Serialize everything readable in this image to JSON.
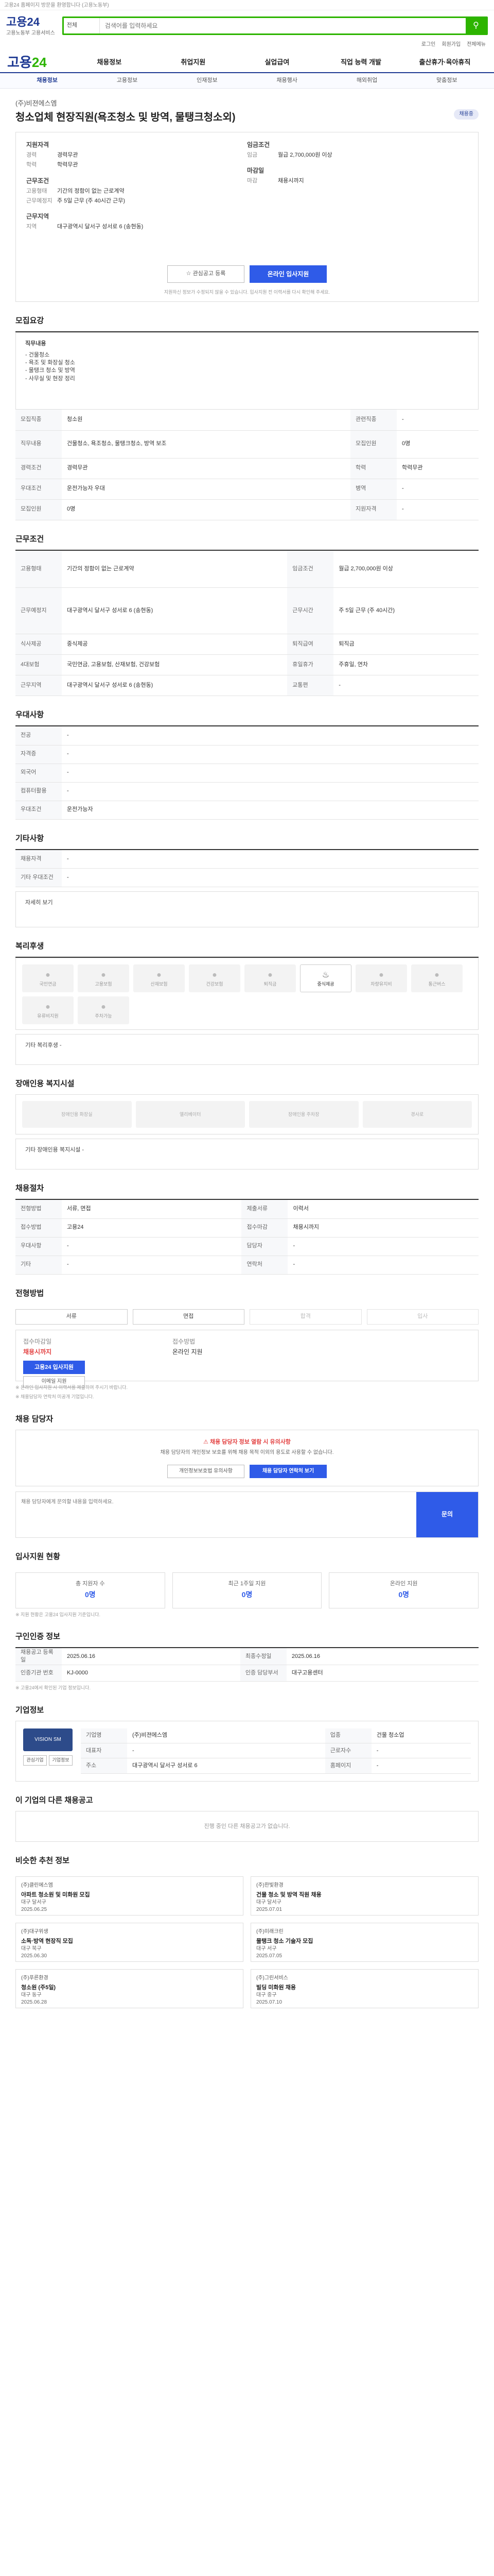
{
  "topbar": "고용24 홈페이지 방문을 환영합니다 (고용노동부)",
  "logo": {
    "main": "고용24",
    "sub": "고용노동부 고용서비스"
  },
  "search": {
    "scope": "전체",
    "placeholder": "검색어를 입력하세요"
  },
  "util": [
    "로그인",
    "회원가입",
    "전체메뉴"
  ],
  "gnb": [
    "채용정보",
    "취업지원",
    "실업급여",
    "직업 능력 개발",
    "출산휴가·육아휴직"
  ],
  "sub": [
    "채용정보",
    "고용정보",
    "인재정보",
    "채용행사",
    "해외취업",
    "맞춤정보"
  ],
  "job": {
    "company": "(주)비젼에스엠",
    "title": "청소업체 현장직원(욕조청소 및 방역, 물탱크청소외)",
    "tag": "채용중",
    "summary": {
      "g1": "지원자격",
      "g1_items": [
        [
          "경력",
          "경력무관"
        ],
        [
          "학력",
          "학력무관"
        ]
      ],
      "g2": "근무조건",
      "g2_items": [
        [
          "고용형태",
          "기간의 정함이 없는 근로계약"
        ],
        [
          "근무예정지",
          "주 5일 근무 (주 40시간 근무)"
        ]
      ],
      "g3": "근무지역",
      "g3_items": [
        [
          "지역",
          "대구광역시 달서구 성서로 6 (송현동)"
        ]
      ],
      "g4": "임금조건",
      "g4_items": [
        [
          "임금",
          "월급 2,700,000원 이상"
        ]
      ],
      "g5": "마감일",
      "g5_items": [
        [
          "마감",
          "채용시까지"
        ]
      ]
    },
    "apply_btn": "온라인 입사지원",
    "save_btn": "관심공고 등록",
    "note": "지원하신 정보가 수정되지 않을 수 있습니다. 입사지원 전 이력서를 다시 확인해 주세요."
  },
  "section_job": {
    "title": "모집요강",
    "desc_title": "직무내용",
    "desc": [
      "- 건물청소",
      "- 욕조 및 화장실 청소",
      "- 물탱크 청소 및 방역",
      "- 사무실 및 현장 정리"
    ],
    "rows": [
      [
        "모집직종",
        "청소원",
        "관련직종",
        "-"
      ],
      [
        "직무내용",
        "건물청소, 욕조청소, 물탱크청소, 방역 보조",
        "모집인원",
        "0명"
      ],
      [
        "경력조건",
        "경력무관",
        "학력",
        "학력무관"
      ],
      [
        "우대조건",
        "운전가능자 우대",
        "병역",
        "-"
      ],
      [
        "모집인원",
        "0명",
        "지원자격",
        "-"
      ]
    ]
  },
  "section_work": {
    "title": "근무조건",
    "rows": [
      [
        "고용형태",
        "기간의 정함이 없는 근로계약",
        "임금조건",
        "월급 2,700,000원 이상"
      ],
      [
        "근무예정지",
        "대구광역시 달서구 성서로 6 (송현동)",
        "근무시간",
        "주 5일 근무 (주 40시간)"
      ],
      [
        "식사제공",
        "중식제공",
        "퇴직급여",
        "퇴직금"
      ],
      [
        "4대보험",
        "국민연금, 고용보험, 산재보험, 건강보험",
        "휴일휴가",
        "주휴일, 연차"
      ],
      [
        "근무지역",
        "대구광역시 달서구 성서로 6 (송현동)",
        "교통편",
        "-"
      ]
    ]
  },
  "section_pref": {
    "title": "우대사항",
    "rows": [
      [
        "전공",
        "-"
      ],
      [
        "자격증",
        "-"
      ],
      [
        "외국어",
        "-"
      ],
      [
        "컴퓨터활용",
        "-"
      ],
      [
        "우대조건",
        "운전가능자"
      ]
    ]
  },
  "section_etc": {
    "title": "기타사항",
    "rows": [
      [
        "채용자격",
        "-"
      ],
      [
        "기타 우대조건",
        "-"
      ]
    ],
    "more": "자세히 보기"
  },
  "section_welfare": {
    "title": "복리후생",
    "items": [
      "국민연금",
      "고용보험",
      "산재보험",
      "건강보험",
      "퇴직금",
      "중식제공",
      "차량유지비",
      "통근버스",
      "유류비지원",
      "주차가능"
    ],
    "active": "중식제공",
    "extra_label": "기타 복리후생",
    "extra": "-"
  },
  "section_disabled": {
    "title": "장애인용 복지시설",
    "items": [
      "장애인용 화장실",
      "엘리베이터",
      "장애인용 주차장",
      "경사로"
    ],
    "extra_label": "기타 장애인용 복지시설",
    "extra": "-"
  },
  "section_process": {
    "title": "채용절차",
    "rows": [
      [
        "전형방법",
        "서류, 면접",
        "제출서류",
        "이력서"
      ],
      [
        "접수방법",
        "고용24",
        "접수마감",
        "채용시까지"
      ],
      [
        "우대사항",
        "-",
        "담당자",
        "-"
      ],
      [
        "기타",
        "-",
        "연락처",
        "-"
      ]
    ]
  },
  "section_apply": {
    "title": "전형방법",
    "steps": [
      "서류",
      "면접",
      "합격",
      "입사"
    ],
    "deadline_label": "접수마감일",
    "deadline": "채용시까지",
    "apply_label": "접수방법",
    "apply_value": "온라인 지원",
    "online_btn": "고용24 입사지원",
    "mail_btn": "이메일 지원",
    "notes": [
      "※ 온라인 입사지원 시 이력서를 제출하여 주시기 바랍니다.",
      "※ 채용담당자 연락처 미공개 기업입니다."
    ]
  },
  "section_contact": {
    "title": "채용 담당자",
    "alert": "채용 담당자 정보 열람 시 유의사항",
    "alert_desc": "채용 담당자의 개인정보 보호를 위해 채용 목적 이외의 용도로 사용할 수 없습니다.",
    "btn1": "개인정보보호법 유의사항",
    "btn2": "채용 담당자 연락처 보기",
    "inquiry_placeholder": "채용 담당자에게 문의할 내용을 입력하세요.",
    "inquiry_btn": "문의"
  },
  "section_stats": {
    "title": "입사지원 현황",
    "items": [
      [
        "총 지원자 수",
        "0명"
      ],
      [
        "최근 1주일 지원",
        "0명"
      ],
      [
        "온라인 지원",
        "0명"
      ]
    ],
    "note": "※ 지원 현황은 고용24 입사지원 기준입니다."
  },
  "section_info": {
    "title": "구인인증 정보",
    "rows": [
      [
        "채용공고 등록일",
        "2025.06.16",
        "최종수정일",
        "2025.06.16"
      ],
      [
        "인증기관 번호",
        "KJ-0000",
        "인증 담당부서",
        "대구고용센터"
      ]
    ],
    "note": "※ 고용24에서 확인된 기업 정보입니다."
  },
  "section_company": {
    "title": "기업정보",
    "logo": "VISION SM",
    "rows": [
      [
        "기업명",
        "(주)비젼에스엠",
        "업종",
        "건물 청소업"
      ],
      [
        "대표자",
        "-",
        "근로자수",
        "-"
      ],
      [
        "주소",
        "대구광역시 달서구 성서로 6",
        "홈페이지",
        "-"
      ]
    ],
    "btns": [
      "관심기업",
      "기업정보"
    ]
  },
  "section_other": {
    "title": "이 기업의 다른 채용공고",
    "empty": "진행 중인 다른 채용공고가 없습니다."
  },
  "section_recommend": {
    "title": "비슷한 추천 정보",
    "cards": [
      [
        "(주)클린에스엠",
        "아파트 청소원 및 미화원 모집",
        "대구 달서구",
        "2025.06.25"
      ],
      [
        "(주)한빛환경",
        "건물 청소 및 방역 직원 채용",
        "대구 달서구",
        "2025.07.01"
      ],
      [
        "(주)대구위생",
        "소독·방역 현장직 모집",
        "대구 북구",
        "2025.06.30"
      ],
      [
        "(주)미래크린",
        "물탱크 청소 기술자 모집",
        "대구 서구",
        "2025.07.05"
      ],
      [
        "(주)푸른환경",
        "청소원 (주5일)",
        "대구 동구",
        "2025.06.28"
      ],
      [
        "(주)그린서비스",
        "빌딩 미화원 채용",
        "대구 중구",
        "2025.07.10"
      ]
    ]
  }
}
